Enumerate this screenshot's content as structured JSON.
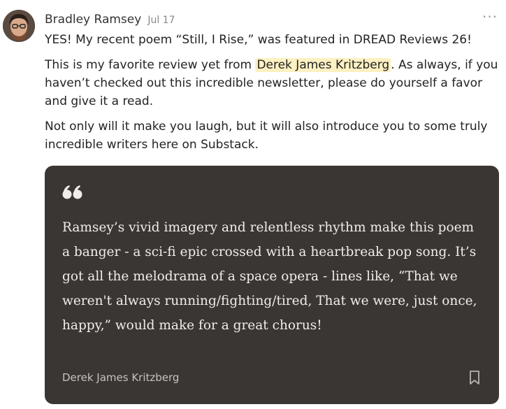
{
  "post": {
    "author": "Bradley Ramsey",
    "date": "Jul 17",
    "more_label": "···",
    "line1": "YES! My recent poem “Still, I Rise,” was featured in DREAD Reviews 26!",
    "p2_before": "This is my favorite review yet from ",
    "p2_mention": "Derek James Kritzberg",
    "p2_after": ". As always, if you haven’t checked out this incredible newsletter, please do yourself a favor and give it a read.",
    "p3": "Not only will it make you laugh, but it will also introduce you to some truly incredible writers here on Substack."
  },
  "quote": {
    "text": "Ramsey’s vivid imagery and relentless rhythm make this poem a banger - a sci-fi epic crossed with a heartbreak pop song. It’s got all the melodrama of a space opera - lines like, “That we weren't always running/fighting/tired, That we were, just once, happy,” would make for a great chorus!",
    "source": "Derek James Kritzberg"
  },
  "icons": {
    "quote": "quote-icon",
    "bookmark": "bookmark-icon",
    "more": "more-options-icon"
  },
  "colors": {
    "card_background": "#3a3633",
    "mention_highlight": "#fdf0c2"
  }
}
